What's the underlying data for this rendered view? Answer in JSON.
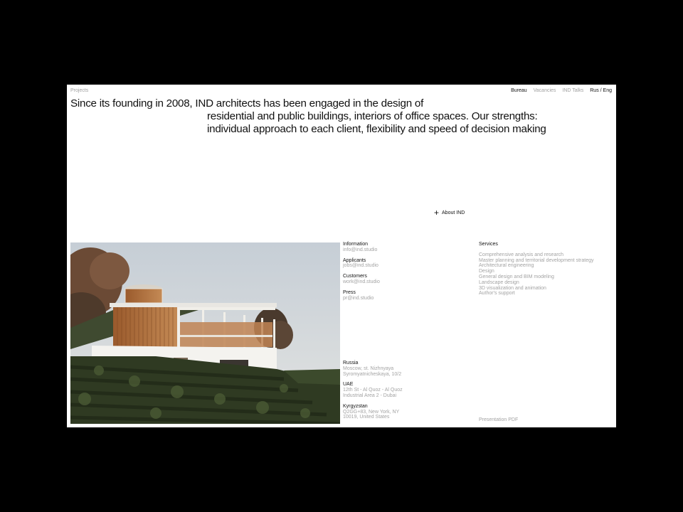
{
  "nav": {
    "projects": "Projects",
    "bureau": "Bureau",
    "vacancies": "Vacancies",
    "talks": "IND Talks",
    "lang": "Rus / Eng"
  },
  "headline": {
    "line1": "Since its founding in 2008, IND architects has been engaged in the design of",
    "line2": "residential and public buildings, interiors of office spaces. Our strengths:",
    "line3": "individual approach to each client, flexibility and speed of decision making"
  },
  "about": {
    "label": "About IND"
  },
  "contacts": [
    {
      "label": "Information",
      "value": "info@ind.studio"
    },
    {
      "label": "Applicants",
      "value": "jobs@ind.studio"
    },
    {
      "label": "Customers",
      "value": "work@ind.studio"
    },
    {
      "label": "Press",
      "value": "pr@ind.studio"
    }
  ],
  "offices": [
    {
      "label": "Russia",
      "line1": "Moscow, st. Nizhnyaya",
      "line2": "Syromyatnicheskaya, 10/2"
    },
    {
      "label": "UAE",
      "line1": "12th St - Al Quoz - Al Quoz",
      "line2": "Industrial Area 2 - Dubai"
    },
    {
      "label": "Kyrgyzstan",
      "line1": "Q2GG+83, New York, NY",
      "line2": "10019, United States"
    }
  ],
  "services": {
    "title": "Services",
    "items": [
      "Comprehensive analysis and research",
      "Master planning and territorial development strategy",
      "Architectural engineering",
      "Design",
      "General design and BIM modeling",
      "Landscape design",
      "3D visualization and animation",
      "Author's support"
    ]
  },
  "presentation": {
    "label": "Presentation PDF"
  },
  "colors": {
    "background": "#000000",
    "page": "#ffffff",
    "text": "#111111",
    "muted": "#a3a3a3"
  },
  "icons": {
    "about": "plus-icon"
  }
}
